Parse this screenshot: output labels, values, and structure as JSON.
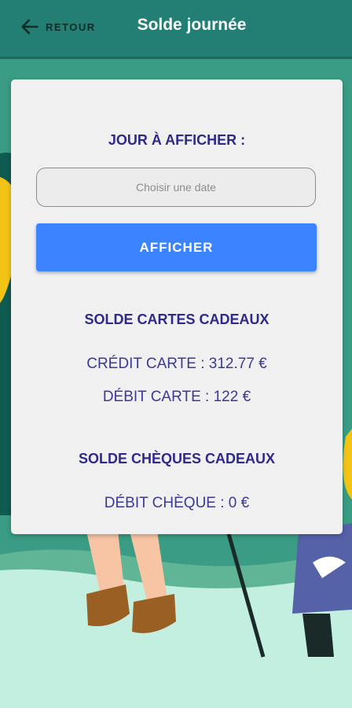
{
  "header": {
    "back_label": "RETOUR",
    "title": "Solde journée"
  },
  "form": {
    "day_label": "JOUR À AFFICHER :",
    "date_placeholder": "Choisir une date",
    "submit_label": "AFFICHER"
  },
  "gift_cards": {
    "title": "SOLDE CARTES CADEAUX",
    "credit": "CRÉDIT CARTE : 312.77 €",
    "debit": "DÉBIT CARTE : 122 €"
  },
  "gift_checks": {
    "title": "SOLDE CHÈQUES CADEAUX",
    "debit": "DÉBIT CHÈQUE : 0 €"
  },
  "colors": {
    "header": "#237f74",
    "accent": "#3b83ff",
    "text": "#2d2a8a",
    "background": "#c2efe0"
  }
}
